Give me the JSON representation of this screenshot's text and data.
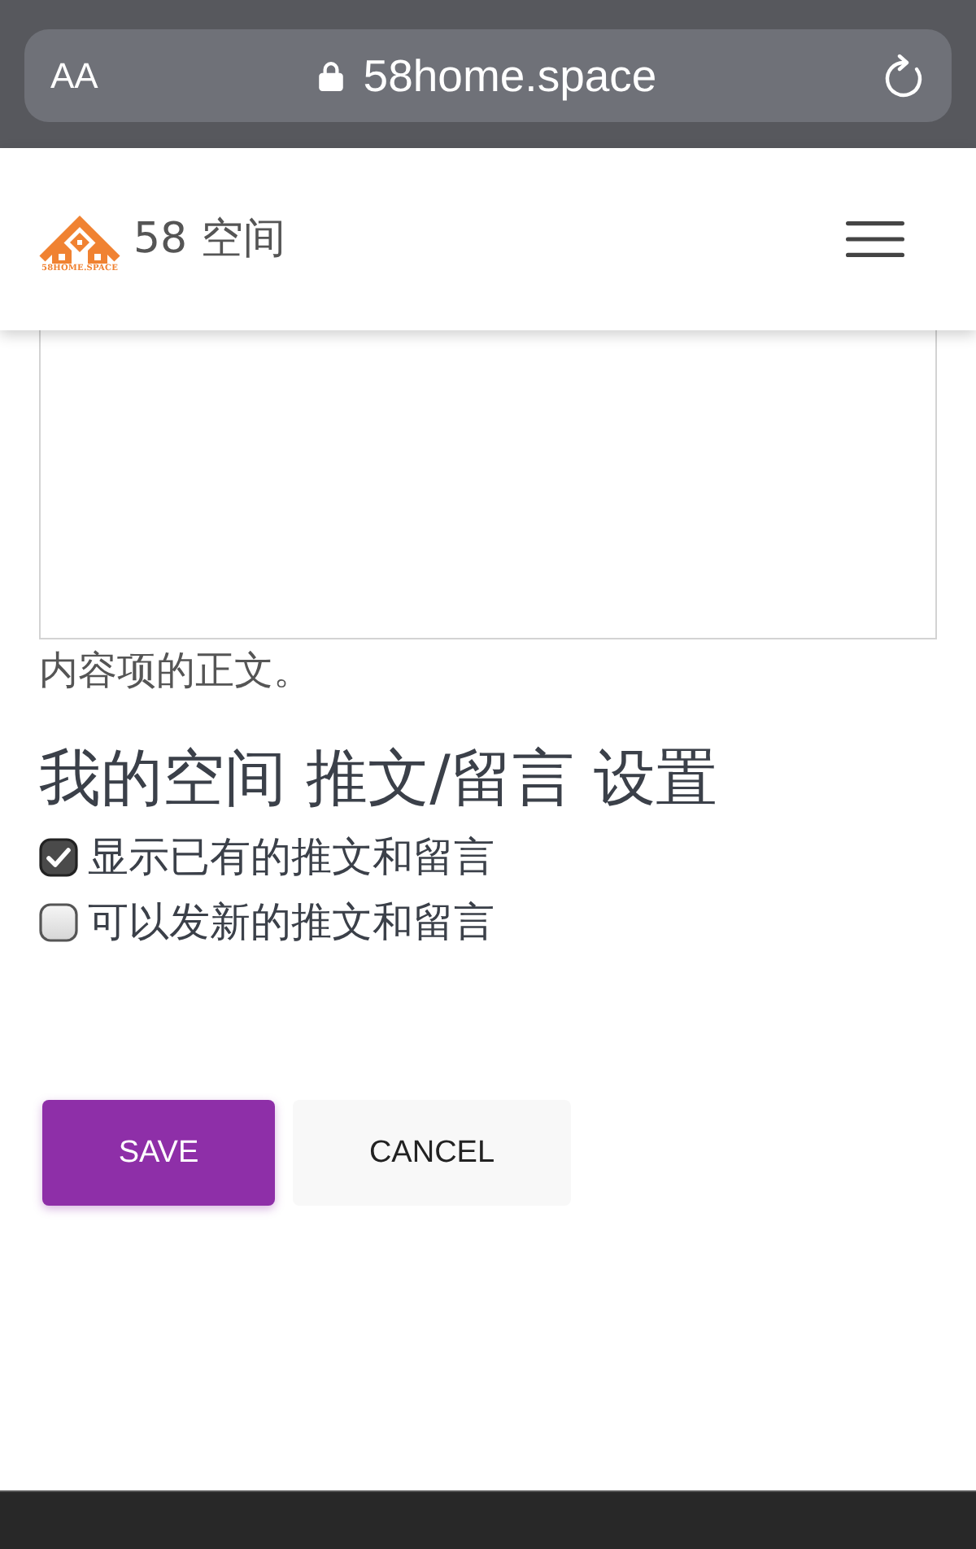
{
  "browser": {
    "text_size_button": "AA",
    "url": "58home.space"
  },
  "header": {
    "logo_caption": "58HOME.SPACE",
    "site_name": "58 空间"
  },
  "content_field": {
    "help_text": "内容项的正文。"
  },
  "settings": {
    "heading": "我的空间 推文/留言 设置",
    "options": [
      {
        "label": "显示已有的推文和留言",
        "checked": true
      },
      {
        "label": "可以发新的推文和留言",
        "checked": false
      }
    ]
  },
  "buttons": [
    {
      "label": "SAVE",
      "kind": "primary"
    },
    {
      "label": "CANCEL",
      "kind": "secondary"
    }
  ]
}
